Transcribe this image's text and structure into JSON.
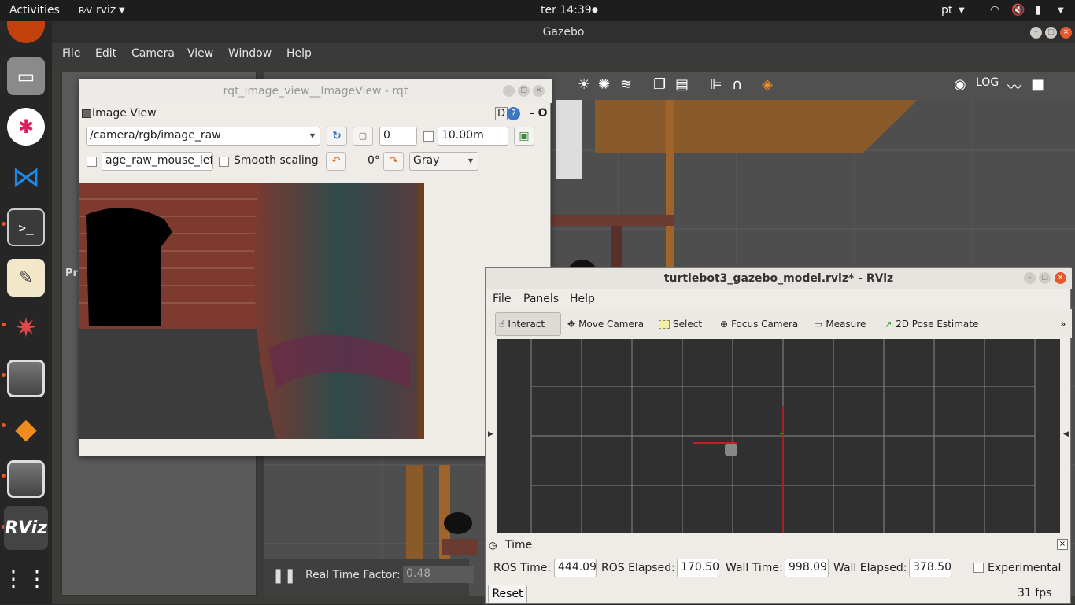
{
  "topbar": {
    "activities": "Activities",
    "app": "rviz",
    "clock": "ter 14:39",
    "lang": "pt"
  },
  "gazebo": {
    "title": "Gazebo",
    "menu": [
      "File",
      "Edit",
      "Camera",
      "View",
      "Window",
      "Help"
    ],
    "realtime_label": "Real Time Factor:",
    "realtime_value": "0.48"
  },
  "rqt": {
    "title": "rqt_image_view__ImageView - rqt",
    "plugin_title": "Image View",
    "help_d": "D",
    "help_o": "- O",
    "topic": "/camera/rgb/image_raw",
    "spin_value": "0",
    "max_range": "10.00m",
    "mouse_topic": "age_raw_mouse_left",
    "smooth_label": "Smooth scaling",
    "rotation": "0°",
    "colormap": "Gray"
  },
  "rviz": {
    "title": "turtlebot3_gazebo_model.rviz* - RViz",
    "menu": [
      "File",
      "Panels",
      "Help"
    ],
    "tools": [
      "Interact",
      "Move Camera",
      "Select",
      "Focus Camera",
      "Measure",
      "2D Pose Estimate"
    ],
    "time": {
      "header": "Time",
      "ros_time_label": "ROS Time:",
      "ros_time": "444.09",
      "ros_elapsed_label": "ROS Elapsed:",
      "ros_elapsed": "170.50",
      "wall_time_label": "Wall Time:",
      "wall_time": "998.09",
      "wall_elapsed_label": "Wall Elapsed:",
      "wall_elapsed": "378.50",
      "experimental_label": "Experimental",
      "reset_label": "Reset",
      "fps": "31 fps"
    }
  },
  "colors": {
    "ubuntu_orange": "#e95420",
    "gazebo_bg": "#4a4a4a",
    "rviz_grid_bg": "#303030"
  }
}
